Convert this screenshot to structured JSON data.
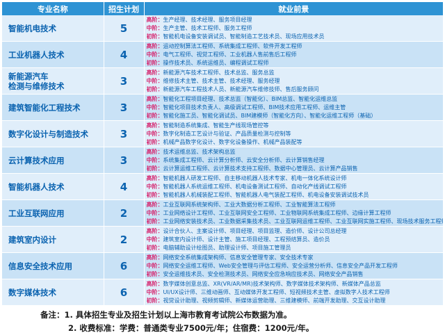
{
  "headers": {
    "name": "专业名称",
    "plan": "招生计划",
    "prospect": "就业前景"
  },
  "rows": [
    {
      "name": [
        "智能机电技术"
      ],
      "count": "5",
      "lines": [
        {
          "level": "高阶：",
          "text": "生产经理、技术经理、服务项目经理"
        },
        {
          "level": "中阶：",
          "text": "生产主管、技术工程师、服务工程师"
        },
        {
          "level": "初阶：",
          "text": "智能机电设备安装调试员、智能制造工艺技术员、现场应用技术员"
        }
      ]
    },
    {
      "name": [
        "工业机器人技术"
      ],
      "count": "4",
      "lines": [
        {
          "level": "高阶：",
          "text": "运动控制算法工程师、系统集成工程师、软件开发工程师"
        },
        {
          "level": "中阶：",
          "text": "电气工程师、视觉工程师、工业机器人售前售后工程师"
        },
        {
          "level": "初阶：",
          "text": "操作技术员、系统运维员、编程调试工程师"
        }
      ]
    },
    {
      "name": [
        "新能源汽车",
        "检测与维修技术"
      ],
      "count": "3",
      "lines": [
        {
          "level": "高阶：",
          "text": "新能源汽车技术工程师、技术总监、服务总监"
        },
        {
          "level": "中阶：",
          "text": "维修技术主管、技术主管、技术经理、服务经理"
        },
        {
          "level": "初阶：",
          "text": "新能源汽车工程技术人员、新能源汽车维修技师、售后服务顾问"
        }
      ]
    },
    {
      "name": [
        "建筑智能化工程技术"
      ],
      "count": "3",
      "lines": [
        {
          "level": "高阶：",
          "text": "智能化工程项目经理、技术总监（智能化）、BIM总监、智能化运维总监"
        },
        {
          "level": "中阶：",
          "text": "智能化项目技术负责人、高级调试工程师、BIM技术应用工程师、运维主管"
        },
        {
          "level": "初阶：",
          "text": "智能化施工员、智能化调试员、BIM建模师（智能化方向）、智能化运维工程师（基础）"
        }
      ]
    },
    {
      "name": [
        "数字化设计与制造技术"
      ],
      "count": "3",
      "lines": [
        {
          "level": "高阶：",
          "text": "智能制造系统集成、智能生产线现场管控等"
        },
        {
          "level": "中阶：",
          "text": "数字化制造工艺设计与验证、产品质量检测与控制等"
        },
        {
          "level": "初阶：",
          "text": "机械产品数字化设计、数字化设备操作、机械产品装配等"
        }
      ]
    },
    {
      "name": [
        "云计算技术应用"
      ],
      "count": "3",
      "lines": [
        {
          "level": "高阶：",
          "text": "技术运维总监、技术架构总监"
        },
        {
          "level": "中阶：",
          "text": "系统集成工程师、云计算分析师、云安全分析师、云计算销售经理"
        },
        {
          "level": "初阶：",
          "text": "云计算运维工程师、云计算技术支持工程师、数据中心管理员、云计算产品销售"
        }
      ]
    },
    {
      "name": [
        "智能机器人技术"
      ],
      "count": "4",
      "lines": [
        {
          "level": "高阶：",
          "text": "智能机器人研发工程师、自主移动机器人技术专家、机电一体化系统设计师"
        },
        {
          "level": "中阶：",
          "text": "智能机器人系统运维工程师、机电设备测试工程师、自动化产线调试工程师"
        },
        {
          "level": "初阶：",
          "text": "智能机器人机械装配工程师、智能机器人电气装配工程师、机电设备安装调试技术员"
        }
      ]
    },
    {
      "name": [
        "工业互联网应用"
      ],
      "count": "2",
      "lines": [
        {
          "level": "高阶：",
          "text": "工业互联网系统架构师、工业大数据分析工程师、工业智能算法工程师"
        },
        {
          "level": "中阶：",
          "text": "工业网络设计工程师、工业互联网安全工程师、工业物联网系统集成工程师、边缘计算工程师"
        },
        {
          "level": "初阶：",
          "text": "工业网络安装技术员、工业数据采集技术员、工业互联网运维工程师、工业互联网实施工程师、现场技术服务工程师"
        }
      ]
    },
    {
      "name": [
        "建筑室内设计"
      ],
      "count": "2",
      "lines": [
        {
          "level": "高阶：",
          "text": "设计合伙人、主案设计师、项目经理、项目监理、造价师、设计公司总经理"
        },
        {
          "level": "中阶：",
          "text": "建筑室内设计师、设计主管、施工项目经理、工程预结算员、造价员"
        },
        {
          "level": "初阶：",
          "text": "电脑辅助设计绘图员、助理设计师、项目施工管理员"
        }
      ]
    },
    {
      "name": [
        "信息安全技术应用"
      ],
      "count": "6",
      "lines": [
        {
          "level": "高阶：",
          "text": "网络安全系统集成架构师、信息安全管理专家、安全技术专家"
        },
        {
          "level": "中阶：",
          "text": "网络安全运维工程师、Web安全管理与评估工程师、安全运营分析师、信息安全产品开发工程师"
        },
        {
          "level": "初阶：",
          "text": "安全运维技术员、安全检测技术员、网络安全应急响应技术员、网络安全产品销售"
        }
      ]
    },
    {
      "name": [
        "数字媒体技术"
      ],
      "count": "6",
      "lines": [
        {
          "level": "高阶：",
          "text": "数字媒体创意总监、XR(VR/AR/MR)技术架构师、数字媒体技术架构师、新媒体产品总监"
        },
        {
          "level": "中阶：",
          "text": "UI/UX设计师、三维动画师、互动媒体开发工程师、短视频技术主管、虚拟数字人技术工程师"
        },
        {
          "level": "初阶：",
          "text": "视觉设计助理、视频剪辑师、新媒体运营助理、三维建模师、前端开发助理、交互设计助理"
        }
      ]
    }
  ],
  "notes": {
    "line1": "备注：1. 具体招生专业及招生计划以上海市教育考试院公布数据为准。",
    "line2": "2. 收费标准：学费：普通类专业7500元/年；住宿费：1200元/年。"
  }
}
